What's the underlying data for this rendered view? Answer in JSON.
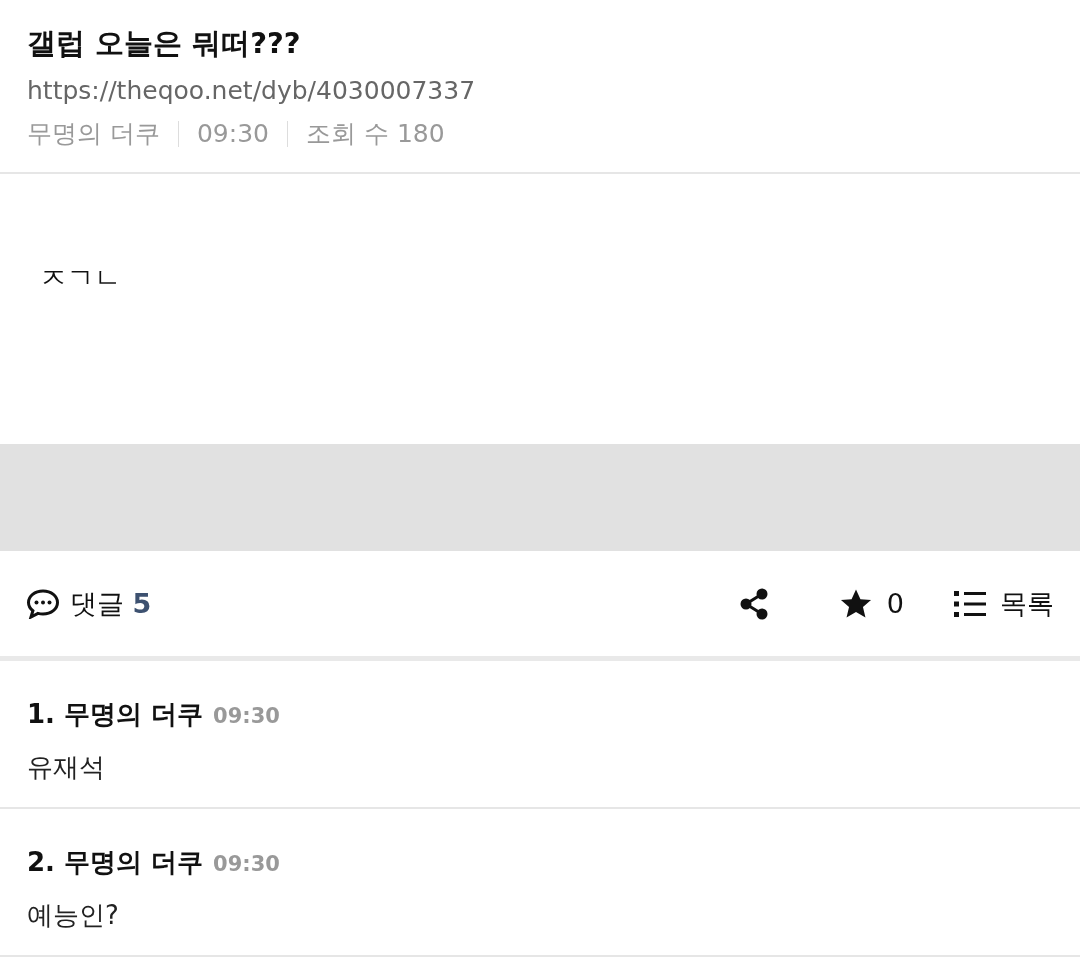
{
  "post": {
    "title": "갤럽 오늘은 뭐떠???",
    "url": "https://theqoo.net/dyb/4030007337",
    "author": "무명의 더쿠",
    "time": "09:30",
    "views": "조회 수 180",
    "body": "ㅈㄱㄴ"
  },
  "actions": {
    "comments_label": "댓글",
    "comments_count": "5",
    "star_count": "0",
    "list_label": "목록"
  },
  "comments": [
    {
      "number": "1.",
      "author": "무명의 더쿠",
      "time": "09:30",
      "text": "유재석"
    },
    {
      "number": "2.",
      "author": "무명의 더쿠",
      "time": "09:30",
      "text": "예능인?"
    }
  ]
}
